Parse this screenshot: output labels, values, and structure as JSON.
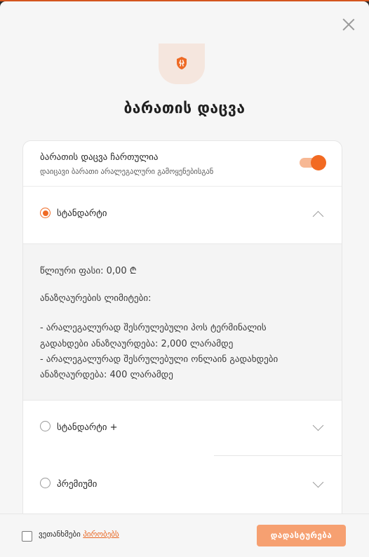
{
  "colors": {
    "accent": "#f26a22",
    "accent_light": "#f6a071",
    "badge_bg": "#f5e6de"
  },
  "icons": {
    "close": "close-icon",
    "badge": "shield-icon"
  },
  "modal": {
    "title": "ბარათის დაცვა",
    "toggle": {
      "title": "ბარათის დაცვა ჩართულია",
      "subtitle": "დაიცავი ბარათი არალეგალური გამოყენებისგან",
      "enabled": true
    },
    "plans": [
      {
        "label": "სტანდარტი",
        "selected": true,
        "expanded": true
      },
      {
        "label": "სტანდარტი +",
        "selected": false,
        "expanded": false
      },
      {
        "label": "პრემიუმი",
        "selected": false,
        "expanded": false
      }
    ],
    "details": {
      "price": "წლიური ფასი: 0,00 ₾",
      "limits_heading": "ანაზღაურების ლიმიტები:",
      "lines": [
        "- არალეგალურად შესრულებული პოს ტერმინალის",
        "გადახდები ანაზღაურდება: 2,000 ლარამდე",
        "- არალეგალურად შესრულებული ონლაინ გადახდები",
        "ანაზღაურდება: 400 ლარამდე"
      ]
    }
  },
  "footer": {
    "agree_text": "ვეთანხმები ",
    "terms_link": "პირობებს",
    "confirm_label": "დადასტურება"
  }
}
